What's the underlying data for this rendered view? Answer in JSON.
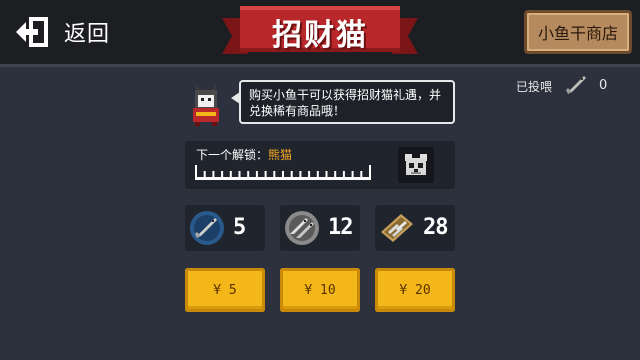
{
  "header": {
    "back_label": "返回",
    "title": "招财猫",
    "shop_label": "小鱼干商店"
  },
  "speech": {
    "text": "购买小鱼干可以获得招财猫礼遇，并兑换稀有商品哦！"
  },
  "fed": {
    "label": "已投喂",
    "count": "0",
    "icon": "fish-icon"
  },
  "unlock": {
    "label": "下一个解锁：",
    "target": "熊猫",
    "progress": 0,
    "icon": "panda-icon"
  },
  "packs": [
    {
      "count": "5",
      "price": "¥ 5",
      "icon": "single-fish-icon"
    },
    {
      "count": "12",
      "price": "¥ 10",
      "icon": "fish-pair-icon"
    },
    {
      "count": "28",
      "price": "¥ 20",
      "icon": "fish-crate-icon"
    }
  ],
  "colors": {
    "accent": "#f5a623",
    "button": "#f4b719",
    "banner": "#b8282a",
    "shop_button": "#b58a5e"
  }
}
